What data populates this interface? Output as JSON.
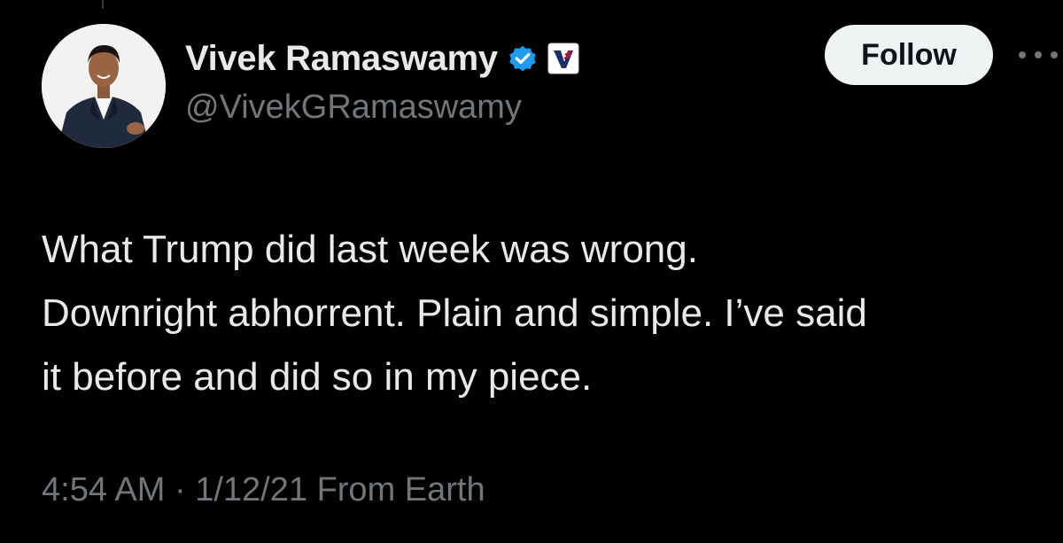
{
  "profile": {
    "display_name": "Vivek Ramaswamy",
    "handle": "@VivekGRamaswamy",
    "verified_icon": "verified-badge-icon",
    "affiliate_icon": "affiliate-badge-icon"
  },
  "actions": {
    "follow_label": "Follow",
    "more_icon": "more-options-icon"
  },
  "tweet": {
    "lines": [
      "What Trump did last week was wrong.",
      "Downright abhorrent. Plain and simple. I’ve said",
      "it before and did so in my piece."
    ],
    "time": "4:54 AM",
    "separator": "·",
    "date": "1/12/21",
    "source": "From Earth"
  },
  "colors": {
    "background": "#000000",
    "text_primary": "#e7e9ea",
    "text_secondary": "#71767b",
    "verified_blue": "#1d9bf0",
    "follow_bg": "#eff3f4"
  }
}
